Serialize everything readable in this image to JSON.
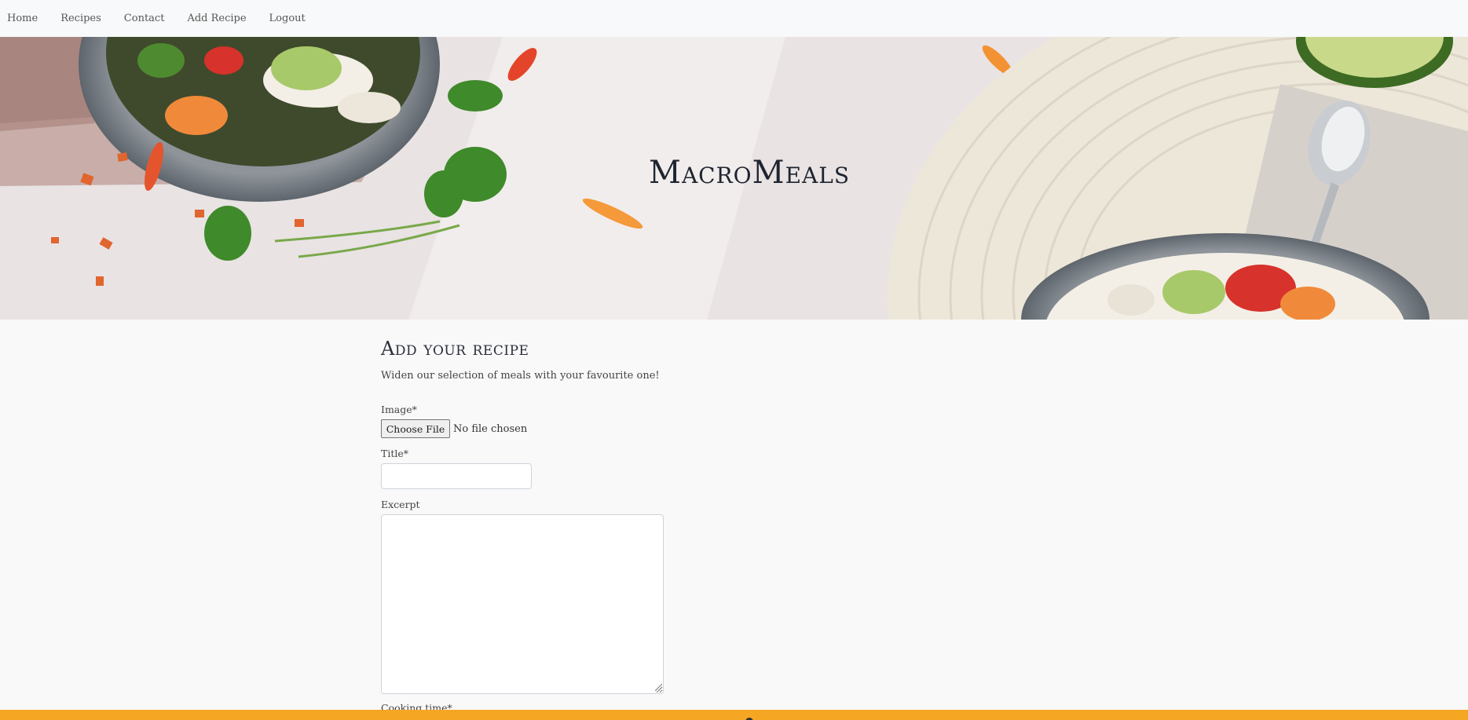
{
  "nav": {
    "items": [
      {
        "label": "Home"
      },
      {
        "label": "Recipes"
      },
      {
        "label": "Contact"
      },
      {
        "label": "Add Recipe"
      },
      {
        "label": "Logout"
      }
    ]
  },
  "hero": {
    "title": "MacroMeals"
  },
  "form": {
    "heading": "Add your recipe",
    "subtitle": "Widen our selection of meals with your favourite one!",
    "image_label": "Image*",
    "file_button": "Choose File",
    "file_status": "No file chosen",
    "title_label": "Title*",
    "title_value": "",
    "excerpt_label": "Excerpt",
    "excerpt_value": "",
    "cooking_time_label": "Cooking time*"
  },
  "colors": {
    "accent": "#f5a623",
    "nav_bg": "#f8f9fa",
    "page_bg": "#f9f9f9"
  }
}
